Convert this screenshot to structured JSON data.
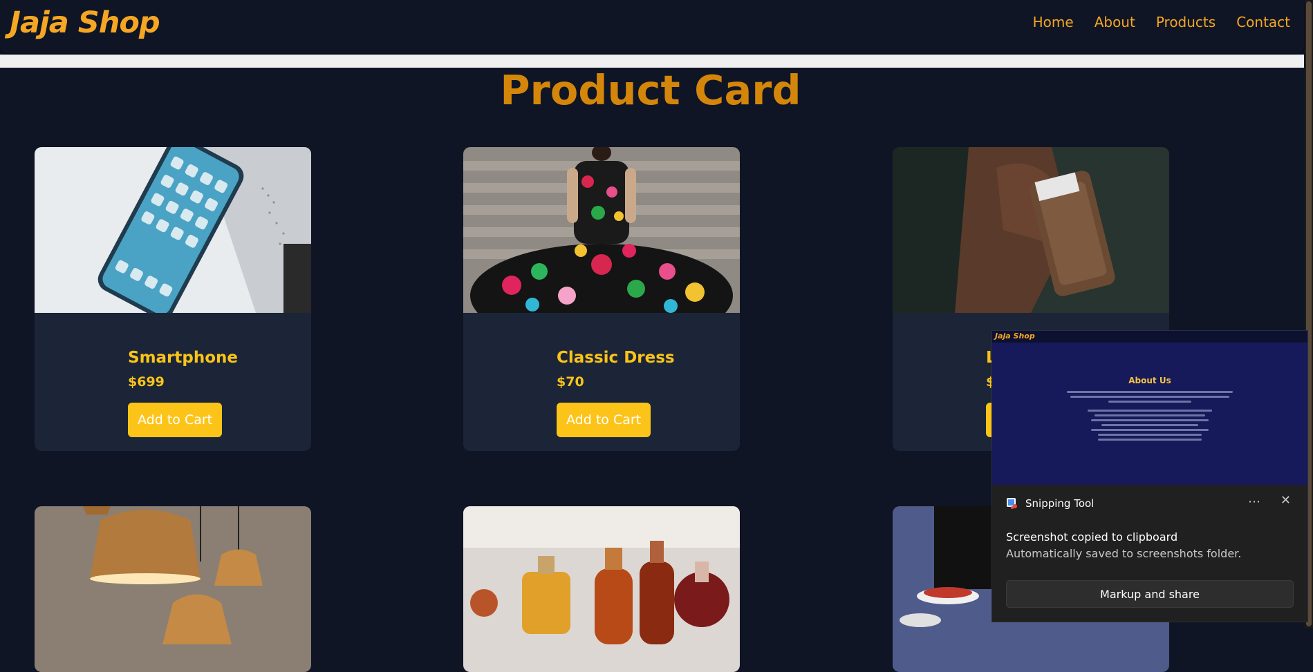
{
  "header": {
    "brand": "Jaja Shop",
    "nav": [
      "Home",
      "About",
      "Products",
      "Contact"
    ]
  },
  "page": {
    "title": "Product Card"
  },
  "products": [
    {
      "name": "Smartphone",
      "price": "$699",
      "button": "Add to Cart",
      "image": "smartphone-photo"
    },
    {
      "name": "Classic Dress",
      "price": "$70",
      "button": "Add to Cart",
      "image": "dress-photo"
    },
    {
      "name": "Le",
      "price": "$3",
      "button": "",
      "image": "wallet-photo"
    },
    {
      "name": "",
      "price": "",
      "button": "",
      "image": "pendant-lamps-photo"
    },
    {
      "name": "",
      "price": "",
      "button": "",
      "image": "perfume-bottles-photo"
    },
    {
      "name": "",
      "price": "",
      "button": "",
      "image": "food-photo"
    }
  ],
  "preview": {
    "brand": "Jaja Shop",
    "title": "About Us"
  },
  "toast": {
    "app": "Snipping Tool",
    "title": "Screenshot copied to clipboard",
    "subtitle": "Automatically saved to screenshots folder.",
    "button": "Markup and share"
  },
  "colors": {
    "background": "#0f1525",
    "card": "#1b2537",
    "accent": "#fcc419",
    "title": "#d4860b"
  }
}
